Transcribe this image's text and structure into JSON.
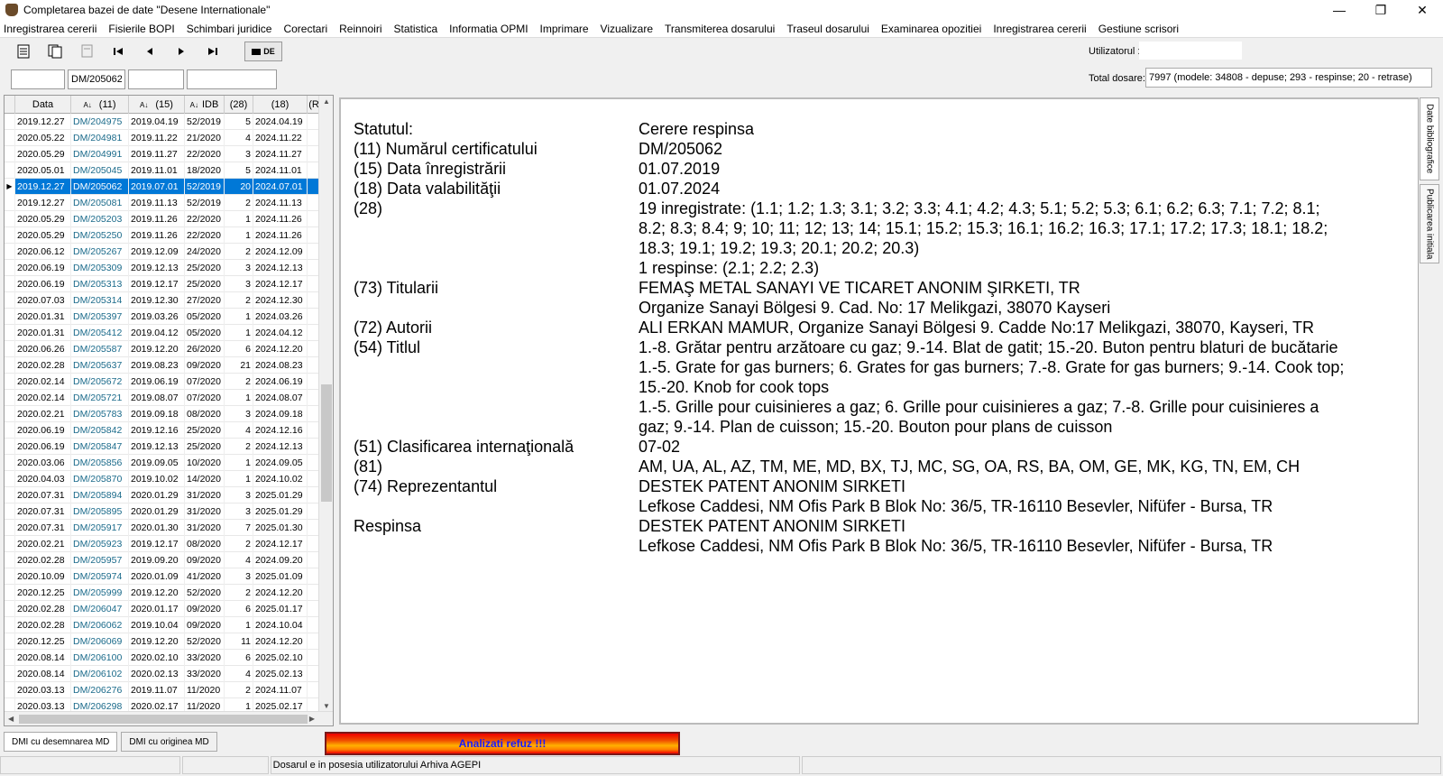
{
  "window": {
    "title": "Completarea bazei de date \"Desene Internationale\"",
    "minimize": "—",
    "maximize": "❐",
    "close": "✕"
  },
  "menu": [
    "Inregistrarea cererii",
    "Fisierile BOPI",
    "Schimbari juridice",
    "Corectari",
    "Reinnoiri",
    "Statistica",
    "Informatia OPMI",
    "Imprimare",
    "Vizualizare",
    "Transmiterea dosarului",
    "Traseul dosarului",
    "Examinarea opozitiei",
    "Inregistrarea cererii",
    "Gestiune scrisori"
  ],
  "toolbar": {
    "de_label": "DE"
  },
  "user": {
    "label": "Utilizatorul :",
    "value": ""
  },
  "filters": {
    "f1": "",
    "f2": "DM/205062",
    "f3": "",
    "f4": ""
  },
  "totals": {
    "label": "Total dosare:",
    "value": "7997 (modele: 34808 - depuse; 293 - respinse; 20 - retrase)"
  },
  "grid": {
    "headers": [
      "Data",
      "(11)",
      "(15)",
      "IDB",
      "(28)",
      "(18)",
      "(R"
    ],
    "rows": [
      [
        "2019.12.27",
        "DM/204975",
        "2019.04.19",
        "52/2019",
        "5",
        "2024.04.19"
      ],
      [
        "2020.05.22",
        "DM/204981",
        "2019.11.22",
        "21/2020",
        "4",
        "2024.11.22"
      ],
      [
        "2020.05.29",
        "DM/204991",
        "2019.11.27",
        "22/2020",
        "3",
        "2024.11.27"
      ],
      [
        "2020.05.01",
        "DM/205045",
        "2019.11.01",
        "18/2020",
        "5",
        "2024.11.01"
      ],
      [
        "2019.12.27",
        "DM/205062",
        "2019.07.01",
        "52/2019",
        "20",
        "2024.07.01"
      ],
      [
        "2019.12.27",
        "DM/205081",
        "2019.11.13",
        "52/2019",
        "2",
        "2024.11.13"
      ],
      [
        "2020.05.29",
        "DM/205203",
        "2019.11.26",
        "22/2020",
        "1",
        "2024.11.26"
      ],
      [
        "2020.05.29",
        "DM/205250",
        "2019.11.26",
        "22/2020",
        "1",
        "2024.11.26"
      ],
      [
        "2020.06.12",
        "DM/205267",
        "2019.12.09",
        "24/2020",
        "2",
        "2024.12.09"
      ],
      [
        "2020.06.19",
        "DM/205309",
        "2019.12.13",
        "25/2020",
        "3",
        "2024.12.13"
      ],
      [
        "2020.06.19",
        "DM/205313",
        "2019.12.17",
        "25/2020",
        "3",
        "2024.12.17"
      ],
      [
        "2020.07.03",
        "DM/205314",
        "2019.12.30",
        "27/2020",
        "2",
        "2024.12.30"
      ],
      [
        "2020.01.31",
        "DM/205397",
        "2019.03.26",
        "05/2020",
        "1",
        "2024.03.26"
      ],
      [
        "2020.01.31",
        "DM/205412",
        "2019.04.12",
        "05/2020",
        "1",
        "2024.04.12"
      ],
      [
        "2020.06.26",
        "DM/205587",
        "2019.12.20",
        "26/2020",
        "6",
        "2024.12.20"
      ],
      [
        "2020.02.28",
        "DM/205637",
        "2019.08.23",
        "09/2020",
        "21",
        "2024.08.23"
      ],
      [
        "2020.02.14",
        "DM/205672",
        "2019.06.19",
        "07/2020",
        "2",
        "2024.06.19"
      ],
      [
        "2020.02.14",
        "DM/205721",
        "2019.08.07",
        "07/2020",
        "1",
        "2024.08.07"
      ],
      [
        "2020.02.21",
        "DM/205783",
        "2019.09.18",
        "08/2020",
        "3",
        "2024.09.18"
      ],
      [
        "2020.06.19",
        "DM/205842",
        "2019.12.16",
        "25/2020",
        "4",
        "2024.12.16"
      ],
      [
        "2020.06.19",
        "DM/205847",
        "2019.12.13",
        "25/2020",
        "2",
        "2024.12.13"
      ],
      [
        "2020.03.06",
        "DM/205856",
        "2019.09.05",
        "10/2020",
        "1",
        "2024.09.05"
      ],
      [
        "2020.04.03",
        "DM/205870",
        "2019.10.02",
        "14/2020",
        "1",
        "2024.10.02"
      ],
      [
        "2020.07.31",
        "DM/205894",
        "2020.01.29",
        "31/2020",
        "3",
        "2025.01.29"
      ],
      [
        "2020.07.31",
        "DM/205895",
        "2020.01.29",
        "31/2020",
        "3",
        "2025.01.29"
      ],
      [
        "2020.07.31",
        "DM/205917",
        "2020.01.30",
        "31/2020",
        "7",
        "2025.01.30"
      ],
      [
        "2020.02.21",
        "DM/205923",
        "2019.12.17",
        "08/2020",
        "2",
        "2024.12.17"
      ],
      [
        "2020.02.28",
        "DM/205957",
        "2019.09.20",
        "09/2020",
        "4",
        "2024.09.20"
      ],
      [
        "2020.10.09",
        "DM/205974",
        "2020.01.09",
        "41/2020",
        "3",
        "2025.01.09"
      ],
      [
        "2020.12.25",
        "DM/205999",
        "2019.12.20",
        "52/2020",
        "2",
        "2024.12.20"
      ],
      [
        "2020.02.28",
        "DM/206047",
        "2020.01.17",
        "09/2020",
        "6",
        "2025.01.17"
      ],
      [
        "2020.02.28",
        "DM/206062",
        "2019.10.04",
        "09/2020",
        "1",
        "2024.10.04"
      ],
      [
        "2020.12.25",
        "DM/206069",
        "2019.12.20",
        "52/2020",
        "11",
        "2024.12.20"
      ],
      [
        "2020.08.14",
        "DM/206100",
        "2020.02.10",
        "33/2020",
        "6",
        "2025.02.10"
      ],
      [
        "2020.08.14",
        "DM/206102",
        "2020.02.13",
        "33/2020",
        "4",
        "2025.02.13"
      ],
      [
        "2020.03.13",
        "DM/206276",
        "2019.11.07",
        "11/2020",
        "2",
        "2024.11.07"
      ],
      [
        "2020.03.13",
        "DM/206298",
        "2020.02.17",
        "11/2020",
        "1",
        "2025.02.17"
      ]
    ],
    "selected_index": 4
  },
  "details": [
    {
      "label": "Statutul:",
      "values": [
        "Cerere respinsa"
      ]
    },
    {
      "label": "(11) Numărul certificatului",
      "values": [
        "DM/205062"
      ]
    },
    {
      "label": "(15) Data înregistrării",
      "values": [
        "01.07.2019"
      ]
    },
    {
      "label": "(18) Data valabilităţii",
      "values": [
        "01.07.2024"
      ]
    },
    {
      "label": "(28)",
      "values": [
        "19 inregistrate: (1.1; 1.2; 1.3; 3.1; 3.2; 3.3; 4.1; 4.2; 4.3; 5.1; 5.2; 5.3; 6.1; 6.2; 6.3; 7.1; 7.2; 8.1;",
        "8.2; 8.3; 8.4; 9; 10; 11; 12; 13; 14; 15.1; 15.2; 15.3; 16.1; 16.2; 16.3; 17.1; 17.2; 17.3; 18.1; 18.2;",
        "18.3; 19.1; 19.2; 19.3; 20.1; 20.2; 20.3)",
        "1 respinse: (2.1; 2.2; 2.3)"
      ]
    },
    {
      "label": "(73) Titularii",
      "values": [
        "FEMAŞ METAL SANAYI VE TICARET ANONIM ŞIRKETI, TR",
        "Organize Sanayi Bölgesi 9. Cad. No: 17 Melikgazi, 38070 Kayseri"
      ]
    },
    {
      "label": "(72) Autorii",
      "values": [
        "ALI ERKAN MAMUR, Organize Sanayi Bölgesi 9. Cadde No:17 Melikgazi, 38070, Kayseri, TR"
      ]
    },
    {
      "label": "(54) Titlul",
      "values": [
        "1.-8. Grătar pentru arzătoare cu gaz; 9.-14. Blat de gatit; 15.-20. Buton pentru blaturi de bucătarie",
        "1.-5. Grate for gas burners; 6. Grates for gas burners; 7.-8. Grate for gas burners; 9.-14. Cook top;",
        "15.-20. Knob for cook tops",
        "1.-5. Grille pour cuisinieres a gaz; 6. Grille pour cuisinieres a gaz; 7.-8. Grille pour cuisinieres a",
        "gaz; 9.-14. Plan de cuisson; 15.-20. Bouton pour plans de cuisson"
      ]
    },
    {
      "label": "(51) Clasificarea internaţională",
      "values": [
        "07-02"
      ]
    },
    {
      "label": "(81)",
      "values": [
        "AM, UA, AL, AZ, TM, ME, MD, BX, TJ, MC, SG, OA, RS, BA, OM, GE, MK, KG, TN, EM, CH"
      ]
    },
    {
      "label": "(74) Reprezentantul",
      "values": [
        "DESTEK PATENT ANONIM SIRKETI",
        "Lefkose Caddesi, NM Ofis Park B Blok No: 36/5, TR-16110 Besevler, Nifüfer - Bursa, TR"
      ]
    },
    {
      "label": "Respinsa",
      "values": [
        "DESTEK PATENT ANONIM SIRKETI",
        "Lefkose Caddesi, NM Ofis Park B Blok No: 36/5, TR-16110 Besevler, Nifüfer - Bursa, TR"
      ]
    }
  ],
  "side_tabs": [
    "Date bibliografice",
    "Publicarea initiala"
  ],
  "bottom_tabs": [
    "DMI cu desemnarea MD",
    "DMI cu originea MD"
  ],
  "alert": "Analizati refuz !!!",
  "status": {
    "message": "Dosarul e in posesia utilizatorului Arhiva AGEPI"
  },
  "colors": {
    "selection": "#0078d7",
    "link_text": "#1a6a8a",
    "alert_text": "#1a1aff"
  }
}
